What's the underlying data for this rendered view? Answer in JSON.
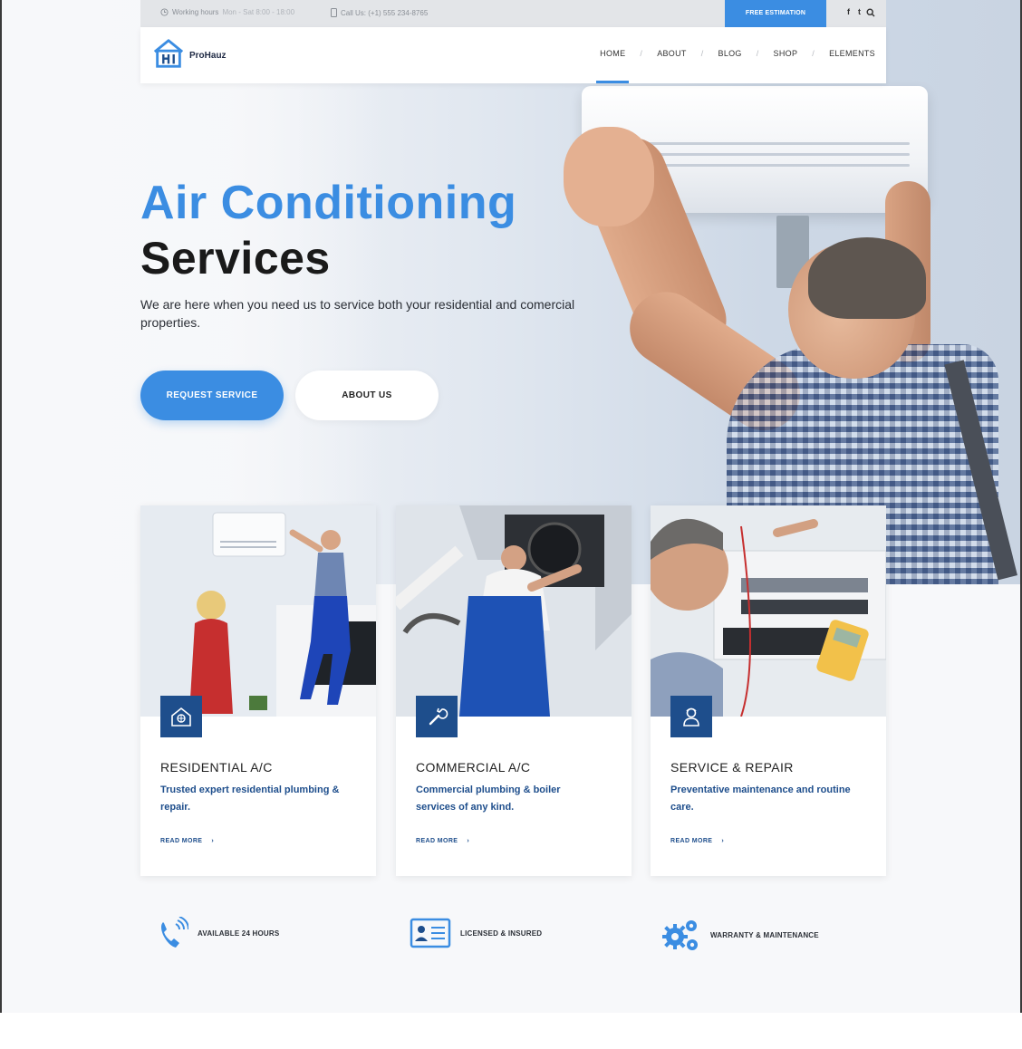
{
  "topbar": {
    "working_hours_label": "Working hours",
    "working_hours_value": "Mon - Sat 8:00 - 18:00",
    "call_label": "Call Us: (+1) 555 234-8765",
    "estimation_button": "FREE ESTIMATION",
    "social": [
      "f",
      "t"
    ]
  },
  "header": {
    "logo_text": "ProHauz",
    "nav": [
      "HOME",
      "ABOUT",
      "BLOG",
      "SHOP",
      "ELEMENTS"
    ],
    "separator": "/"
  },
  "hero": {
    "title_line1": "Air Conditioning",
    "title_line2": "Services",
    "subtitle": "We are here when you need us to service both your residential and comercial properties.",
    "primary_button": "REQUEST SERVICE",
    "secondary_button": "ABOUT US"
  },
  "services": [
    {
      "title": "RESIDENTIAL A/C",
      "description": "Trusted expert residential plumbing & repair.",
      "link": "READ MORE",
      "icon": "house-icon"
    },
    {
      "title": "COMMERCIAL A/C",
      "description": "Commercial plumbing & boiler services of any kind.",
      "link": "READ MORE",
      "icon": "wrench-icon"
    },
    {
      "title": "SERVICE & REPAIR",
      "description": "Preventative maintenance and routine care.",
      "link": "READ MORE",
      "icon": "technician-icon"
    }
  ],
  "link_arrow": "›",
  "features": [
    {
      "label": "AVAILABLE 24 HOURS",
      "icon": "phone-icon"
    },
    {
      "label": "LICENSED & INSURED",
      "icon": "id-card-icon"
    },
    {
      "label": "WARRANTY & MAINTENANCE",
      "icon": "gears-icon"
    }
  ],
  "colors": {
    "accent": "#3b8de2",
    "dark_blue": "#1e4e8c"
  }
}
